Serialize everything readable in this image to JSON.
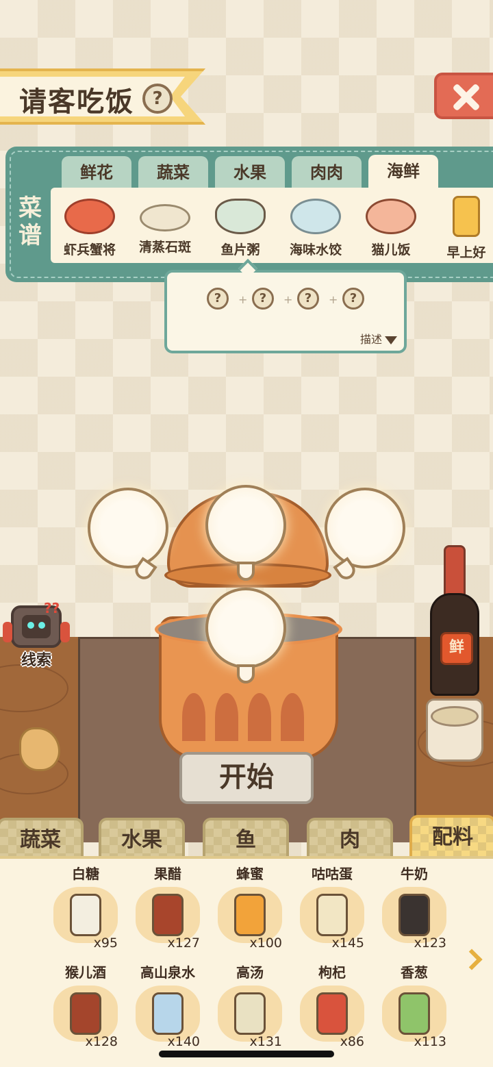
{
  "header": {
    "title": "请客吃饭",
    "help_icon": "?"
  },
  "recipe": {
    "label": "菜谱",
    "tabs": [
      "鲜花",
      "蔬菜",
      "水果",
      "肉肉",
      "海鲜"
    ],
    "active_tab": "海鲜",
    "dishes": [
      "虾兵蟹将",
      "清蒸石斑",
      "鱼片粥",
      "海味水饺",
      "猫儿饭",
      "早上好"
    ]
  },
  "popup": {
    "slots": [
      "?",
      "?",
      "?",
      "?"
    ],
    "plus": "+",
    "desc_label": "描述"
  },
  "kitchen": {
    "start_label": "开始",
    "clue_label": "线索",
    "clue_marks": "??",
    "bottle_label": "鲜"
  },
  "categories": [
    "蔬菜",
    "水果",
    "鱼",
    "肉",
    "配料"
  ],
  "active_category": "配料",
  "items": [
    {
      "name": "白糖",
      "count": "x95",
      "color": "#f3eee0"
    },
    {
      "name": "果醋",
      "count": "x127",
      "color": "#a8452c"
    },
    {
      "name": "蜂蜜",
      "count": "x100",
      "color": "#f2a33a"
    },
    {
      "name": "咕咕蛋",
      "count": "x145",
      "color": "#f2e6c4"
    },
    {
      "name": "牛奶",
      "count": "x123",
      "color": "#3a3330"
    },
    {
      "name": "猴儿酒",
      "count": "x128",
      "color": "#a4452c"
    },
    {
      "name": "高山泉水",
      "count": "x140",
      "color": "#b7d6ea"
    },
    {
      "name": "高汤",
      "count": "x131",
      "color": "#e9e1c2"
    },
    {
      "name": "枸杞",
      "count": "x86",
      "color": "#d9533d"
    },
    {
      "name": "香葱",
      "count": "x113",
      "color": "#8fc46a"
    }
  ]
}
